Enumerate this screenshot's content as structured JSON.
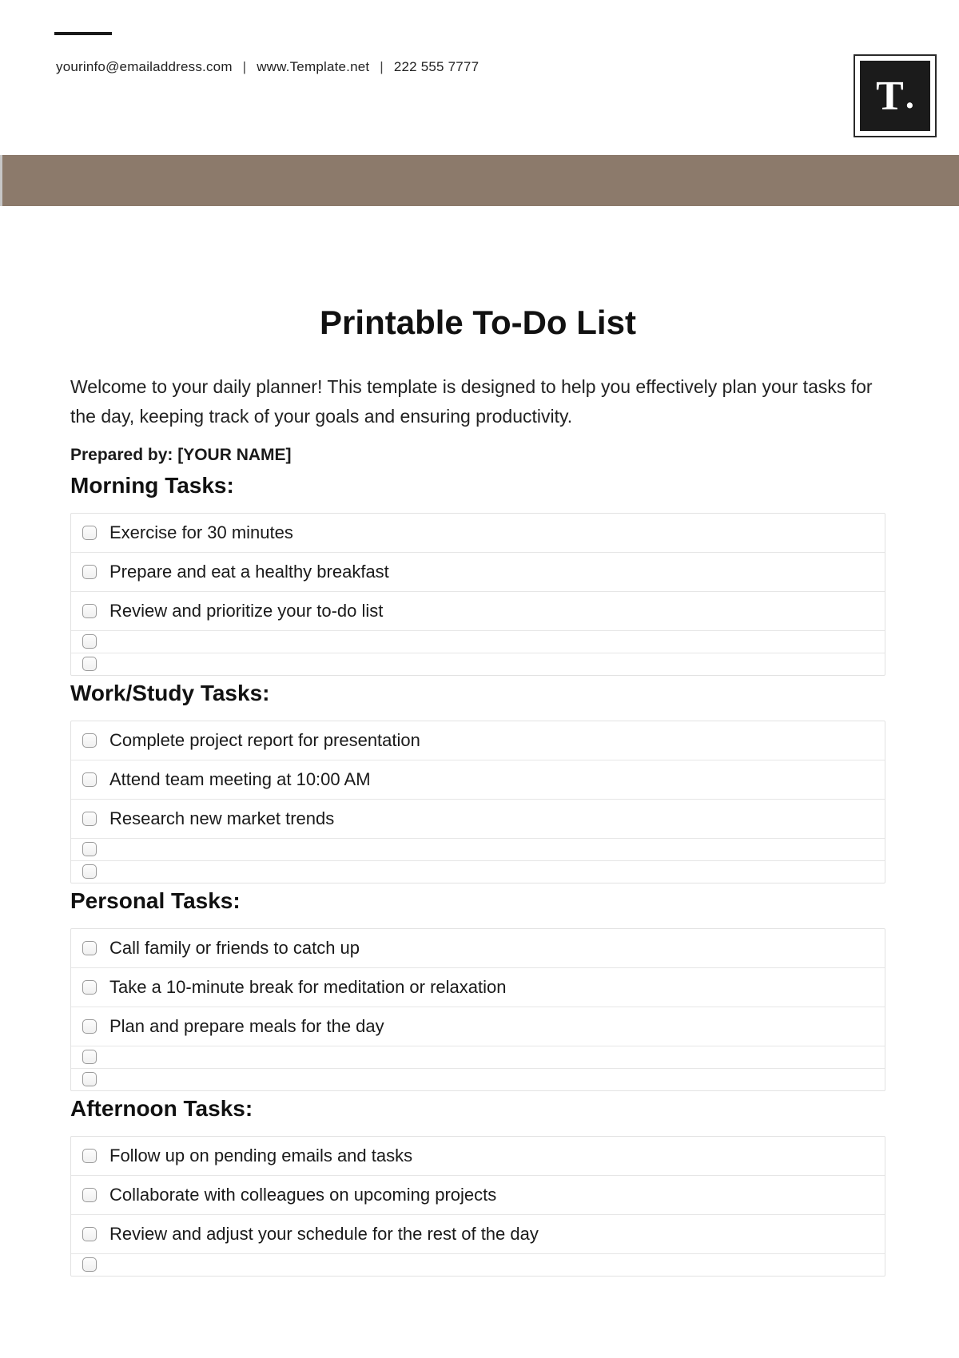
{
  "header": {
    "email": "yourinfo@emailaddress.com",
    "website": "www.Template.net",
    "phone": "222 555 7777",
    "logo_text": "T",
    "logo_dot": "."
  },
  "title": "Printable To-Do List",
  "intro": "Welcome to your daily planner! This template is designed to help you effectively plan your tasks for the day, keeping track of your goals and ensuring productivity.",
  "prepared_by_label": "Prepared by: ",
  "prepared_by_value": "[YOUR NAME]",
  "sections": {
    "morning": {
      "heading": "Morning Tasks:",
      "items": [
        "Exercise for 30 minutes",
        "Prepare and eat a healthy breakfast",
        "Review and prioritize your to-do list",
        "",
        ""
      ]
    },
    "work": {
      "heading": "Work/Study Tasks:",
      "items": [
        "Complete project report for presentation",
        "Attend team meeting at 10:00 AM",
        "Research new market trends",
        "",
        ""
      ]
    },
    "personal": {
      "heading": "Personal Tasks:",
      "items": [
        "Call family or friends to catch up",
        "Take a 10-minute break for meditation or relaxation",
        "Plan and prepare meals for the day",
        "",
        ""
      ]
    },
    "afternoon": {
      "heading": "Afternoon Tasks:",
      "items": [
        "Follow up on pending emails and tasks",
        "Collaborate with colleagues on upcoming projects",
        "Review and adjust your schedule for the rest of the day",
        ""
      ]
    }
  }
}
